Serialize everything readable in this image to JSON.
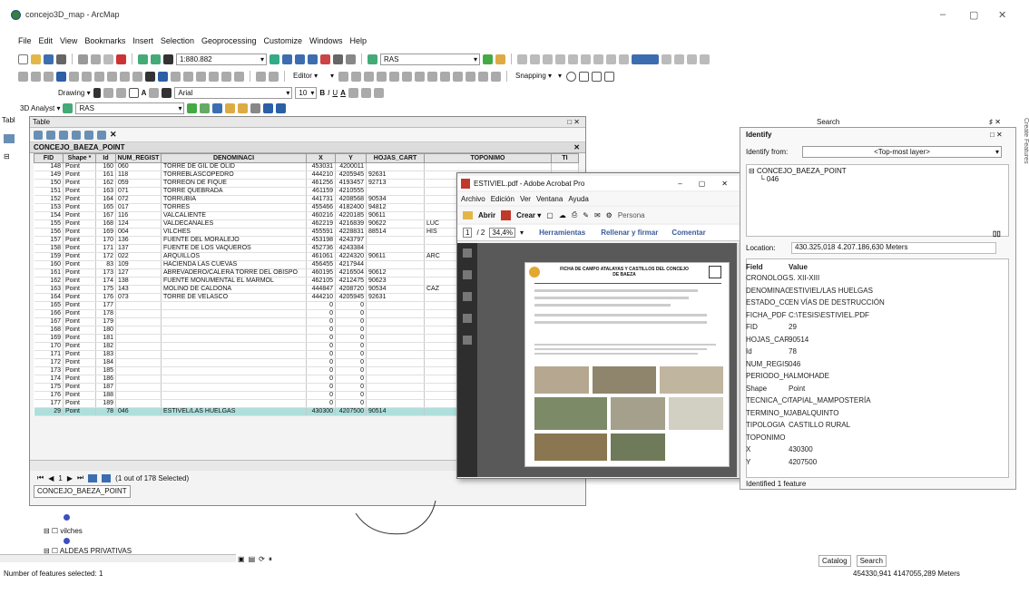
{
  "window": {
    "title": "concejo3D_map - ArcMap",
    "minimize": "–",
    "restore": "▢",
    "close": "✕"
  },
  "menu": [
    "File",
    "Edit",
    "View",
    "Bookmarks",
    "Insert",
    "Selection",
    "Geoprocessing",
    "Customize",
    "Windows",
    "Help"
  ],
  "toolbars": {
    "scale": "1:880.882",
    "layer_combo": "RAS",
    "editor": "Editor ▾",
    "snapping": "Snapping ▾",
    "drawing": "Drawing ▾",
    "font": "Arial",
    "font_size": "10",
    "bold": "B",
    "italic": "I",
    "underline": "U",
    "analyst": "3D Analyst ▾",
    "analyst_layer": "RAS"
  },
  "side_tab": "Tabl",
  "table": {
    "title": "Table",
    "layer": "CONCEJO_BAEZA_POINT",
    "columns": [
      "FID",
      "Shape *",
      "Id",
      "NUM_REGIST",
      "DENOMINACI",
      "X",
      "Y",
      "HOJAS_CART",
      "TOPONIMO",
      "TI"
    ],
    "rows": [
      [
        "148",
        "Point",
        "160",
        "060",
        "TORRE DE GIL DE OLID",
        "453031",
        "4200011",
        "",
        ""
      ],
      [
        "149",
        "Point",
        "161",
        "118",
        "TORREBLASCOPEDRO",
        "444210",
        "4205945",
        "92631",
        ""
      ],
      [
        "150",
        "Point",
        "162",
        "059",
        "TORREÓN DE FIQUÉ",
        "461256",
        "4193457",
        "92713",
        ""
      ],
      [
        "151",
        "Point",
        "163",
        "071",
        "TORRE QUEBRADA",
        "461159",
        "4210555",
        "",
        ""
      ],
      [
        "152",
        "Point",
        "164",
        "072",
        "TORRUBIA",
        "441731",
        "4208568",
        "90534",
        ""
      ],
      [
        "153",
        "Point",
        "165",
        "017",
        "TORRES",
        "455466",
        "4182400",
        "94812",
        ""
      ],
      [
        "154",
        "Point",
        "167",
        "116",
        "VALCALIENTE",
        "460216",
        "4220185",
        "90611",
        ""
      ],
      [
        "155",
        "Point",
        "168",
        "124",
        "VALDECANALES",
        "462219",
        "4216839",
        "90622",
        "LUC"
      ],
      [
        "156",
        "Point",
        "169",
        "004",
        "VILCHES",
        "455591",
        "4228831",
        "88514",
        "HIS"
      ],
      [
        "157",
        "Point",
        "170",
        "136",
        "FUENTE DEL MORALEJO",
        "453198",
        "4243797",
        "",
        ""
      ],
      [
        "158",
        "Point",
        "171",
        "137",
        "FUENTE DE LOS VAQUEROS",
        "452736",
        "4243384",
        "",
        ""
      ],
      [
        "159",
        "Point",
        "172",
        "022",
        "ARQUILLOS",
        "461061",
        "4224320",
        "90611",
        "ARC"
      ],
      [
        "160",
        "Point",
        "83",
        "109",
        "HACIENDA LAS CUEVAS",
        "456455",
        "4217944",
        "",
        ""
      ],
      [
        "161",
        "Point",
        "173",
        "127",
        "ABREVADERO/CALERA TORRE DEL OBISPO",
        "460195",
        "4216504",
        "90612",
        ""
      ],
      [
        "162",
        "Point",
        "174",
        "138",
        "FUENTE MONUMENTAL EL MARMOL",
        "462105",
        "4212475",
        "90623",
        ""
      ],
      [
        "163",
        "Point",
        "175",
        "143",
        "MOLINO DE CALDONA",
        "444847",
        "4208720",
        "90534",
        "CAZ"
      ],
      [
        "164",
        "Point",
        "176",
        "073",
        "TORRE DE VELASCO",
        "444210",
        "4205945",
        "92631",
        ""
      ],
      [
        "165",
        "Point",
        "177",
        "",
        "",
        "0",
        "0",
        "",
        ""
      ],
      [
        "166",
        "Point",
        "178",
        "",
        "",
        "0",
        "0",
        "",
        ""
      ],
      [
        "167",
        "Point",
        "179",
        "",
        "",
        "0",
        "0",
        "",
        ""
      ],
      [
        "168",
        "Point",
        "180",
        "",
        "",
        "0",
        "0",
        "",
        ""
      ],
      [
        "169",
        "Point",
        "181",
        "",
        "",
        "0",
        "0",
        "",
        ""
      ],
      [
        "170",
        "Point",
        "182",
        "",
        "",
        "0",
        "0",
        "",
        ""
      ],
      [
        "171",
        "Point",
        "183",
        "",
        "",
        "0",
        "0",
        "",
        ""
      ],
      [
        "172",
        "Point",
        "184",
        "",
        "",
        "0",
        "0",
        "",
        ""
      ],
      [
        "173",
        "Point",
        "185",
        "",
        "",
        "0",
        "0",
        "",
        ""
      ],
      [
        "174",
        "Point",
        "186",
        "",
        "",
        "0",
        "0",
        "",
        ""
      ],
      [
        "175",
        "Point",
        "187",
        "",
        "",
        "0",
        "0",
        "",
        ""
      ],
      [
        "176",
        "Point",
        "188",
        "",
        "",
        "0",
        "0",
        "",
        ""
      ],
      [
        "177",
        "Point",
        "189",
        "",
        "",
        "0",
        "0",
        "",
        ""
      ],
      [
        "29",
        "Point",
        "78",
        "046",
        "ESTIVEL/LAS HUELGAS",
        "430300",
        "4207500",
        "90514",
        ""
      ]
    ],
    "selected_row": 30,
    "record_first": "1",
    "selection_text": "(1 out of 178 Selected)",
    "tab": "CONCEJO_BAEZA_POINT"
  },
  "toc": {
    "items": [
      "vilches",
      "ALDEAS PRIVATIVAS"
    ]
  },
  "acrobat": {
    "title": "ESTIVIEL.pdf - Adobe Acrobat Pro",
    "menu": [
      "Archivo",
      "Edición",
      "Ver",
      "Ventana",
      "Ayuda"
    ],
    "open": "Abrir",
    "create": "Crear ▾",
    "persona": "Persona",
    "page_current": "1",
    "page_total": "/ 2",
    "zoom": "34,4%",
    "tools": "Herramientas",
    "fill_sign": "Rellenar y firmar",
    "comment": "Comentar",
    "doc_title": "FICHA DE CAMPO ATALAYAS Y CASTILLOS DEL CONCEJO DE BAEZA"
  },
  "identify": {
    "search": "Search",
    "title": "Identify",
    "from_label": "Identify from:",
    "from_value": "<Top-most layer>",
    "tree_root": "CONCEJO_BAEZA_POINT",
    "tree_child": "046",
    "location_label": "Location:",
    "location_value": "430.325,018  4.207.186,630 Meters",
    "col_field": "Field",
    "col_value": "Value",
    "fields": [
      [
        "CRONOLOGIA",
        "S. XII-XIII"
      ],
      [
        "DENOMINACI",
        "ESTIVIEL/LAS HUELGAS"
      ],
      [
        "ESTADO_CON",
        "EN VÍAS DE DESTRUCCIÓN"
      ],
      [
        "FICHA_PDF",
        "C:\\TESIS\\ESTIVIEL.PDF"
      ],
      [
        "FID",
        "29"
      ],
      [
        "HOJAS_CART",
        "90514"
      ],
      [
        "Id",
        "78"
      ],
      [
        "NUM_REGIST",
        "046"
      ],
      [
        "PERIODO_HI",
        "ALMOHADE"
      ],
      [
        "Shape",
        "Point"
      ],
      [
        "TECNICA_CO",
        "TAPIAL_MAMPOSTERÍA"
      ],
      [
        "TERMINO_MU",
        "JABALQUINTO"
      ],
      [
        "TIPOLOGIA",
        "CASTILLO RURAL"
      ],
      [
        "TOPONIMO",
        ""
      ],
      [
        "X",
        "430300"
      ],
      [
        "Y",
        "4207500"
      ]
    ],
    "footer": "Identified 1 feature",
    "create_features": "Create Features"
  },
  "bottom_tabs": {
    "catalog": "Catalog",
    "search": "Search"
  },
  "status": {
    "left": "Number of features selected: 1",
    "right": "454330,941  4147055,289 Meters"
  }
}
